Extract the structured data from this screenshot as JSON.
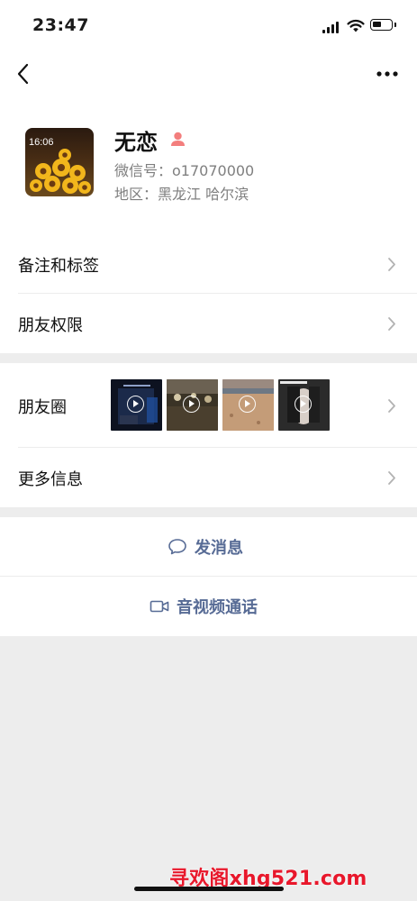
{
  "status_bar": {
    "time": "23:47"
  },
  "profile": {
    "name": "无恋",
    "wechat_id": "微信号：o17070000",
    "region": "地区：黑龙江 哈尔滨",
    "avatar_time": "16:06"
  },
  "rows": {
    "remarks_tags": "备注和标签",
    "friend_permissions": "朋友权限",
    "moments": "朋友圈",
    "more_info": "更多信息"
  },
  "actions": {
    "send_message": "发消息",
    "video_call": "音视频通话"
  },
  "watermark": "寻欢阁xhg521.com",
  "colors": {
    "link": "#576b95",
    "background": "#ededed",
    "gender_female": "#f37e7d"
  }
}
